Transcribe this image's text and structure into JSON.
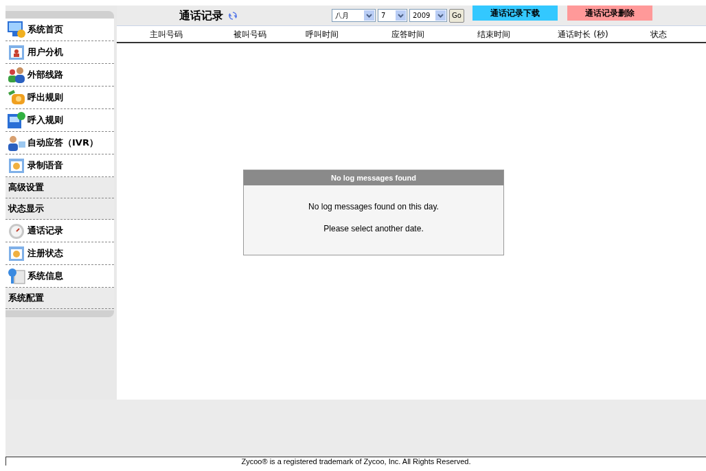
{
  "sidebar": {
    "items": [
      {
        "kind": "link",
        "label": "系统首页"
      },
      {
        "kind": "link",
        "label": "用户分机"
      },
      {
        "kind": "link",
        "label": "外部线路"
      },
      {
        "kind": "link",
        "label": "呼出规则"
      },
      {
        "kind": "link",
        "label": "呼入规则"
      },
      {
        "kind": "link",
        "label": "自动应答（IVR）"
      },
      {
        "kind": "link",
        "label": "录制语音"
      },
      {
        "kind": "section",
        "label": "高级设置"
      },
      {
        "kind": "section",
        "label": "状态显示"
      },
      {
        "kind": "link",
        "label": "通话记录"
      },
      {
        "kind": "link",
        "label": "注册状态"
      },
      {
        "kind": "link",
        "label": "系统信息"
      },
      {
        "kind": "section",
        "label": "系统配置"
      }
    ]
  },
  "header": {
    "title": "通话记录",
    "month": "八月",
    "day": "7",
    "year": "2009",
    "go": "Go",
    "download": "通话记录下载",
    "delete": "通话记录删除"
  },
  "table": {
    "columns": [
      "主叫号码",
      "被叫号码",
      "呼叫时间",
      "应答时间",
      "结束时间",
      "通话时长 (秒)",
      "状态"
    ]
  },
  "dialog": {
    "title": "No log messages found",
    "lines": [
      "No log messages found on this day.",
      "Please select another date."
    ]
  },
  "footer": "Zycoo® is a registered trademark of Zycoo, Inc. All Rights Reserved."
}
